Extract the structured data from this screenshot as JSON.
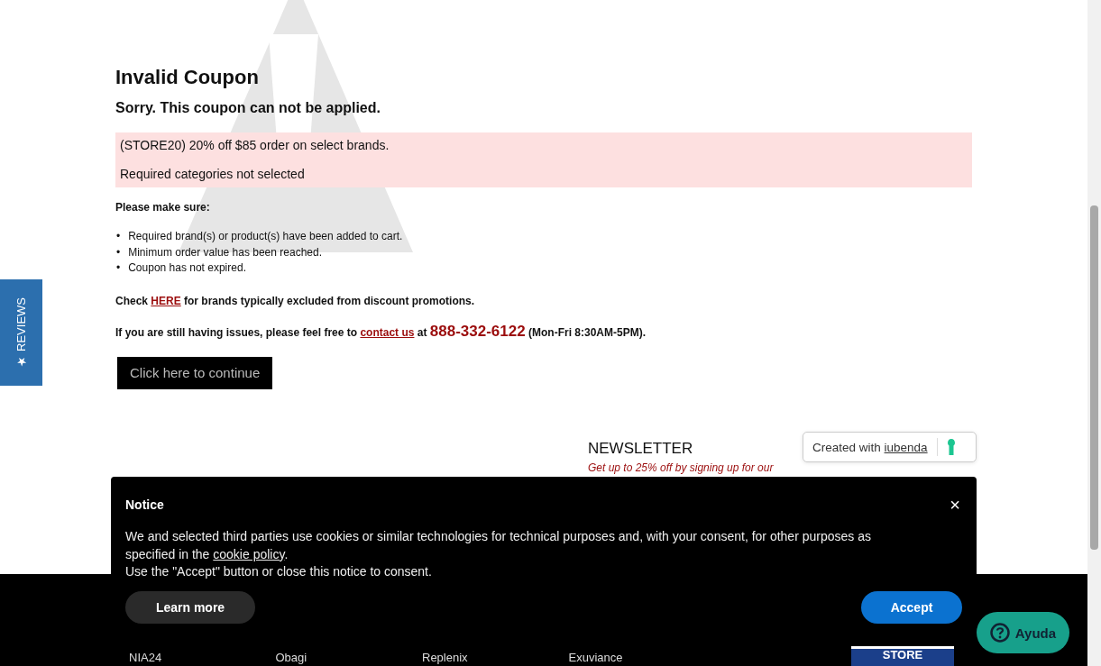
{
  "notice_page": {
    "title": "Invalid Coupon",
    "subtitle": "Sorry. This coupon can not be applied.",
    "error_lines": [
      "(STORE20) 20% off $85 order on select brands.",
      "Required categories not selected"
    ],
    "checklist_heading": "Please make sure:",
    "bullet": "•",
    "checklist": [
      "Required brand(s) or product(s) have been added to cart.",
      "Minimum order value has been reached.",
      "Coupon has not expired."
    ],
    "excluded_note": {
      "before": "Check ",
      "link": "HERE",
      "after": " for brands typically excluded from discount promotions."
    },
    "contact_note": {
      "before": "If you are still having issues, please feel free to ",
      "link": "contact us",
      "middle": " at ",
      "phone": "888-332-6122",
      "after": " (Mon-Fri 8:30AM-5PM)."
    },
    "continue_button": "Click here to continue"
  },
  "reviews_tab": "★ REVIEWS",
  "newsletter": {
    "title": "NEWSLETTER",
    "tagline": "Get up to 25% off by signing up for our"
  },
  "iubenda_badge": {
    "text": "Created with ",
    "link": "iubenda"
  },
  "cookie_notice": {
    "title": "Notice",
    "close": "×",
    "text_before": "We and selected third parties use cookies or similar technologies for technical purposes and, with your consent, for other purposes as specified in the ",
    "link": "cookie policy",
    "text_after": ".",
    "second_line": "Use the \"Accept\" button or close this notice to consent.",
    "learn_more": "Learn more",
    "accept": "Accept"
  },
  "footer": {
    "brands": [
      "NIA24",
      "Obagi",
      "Replenix",
      "Exuviance"
    ],
    "logo_text": "STORE"
  },
  "help_button": "Ayuda"
}
